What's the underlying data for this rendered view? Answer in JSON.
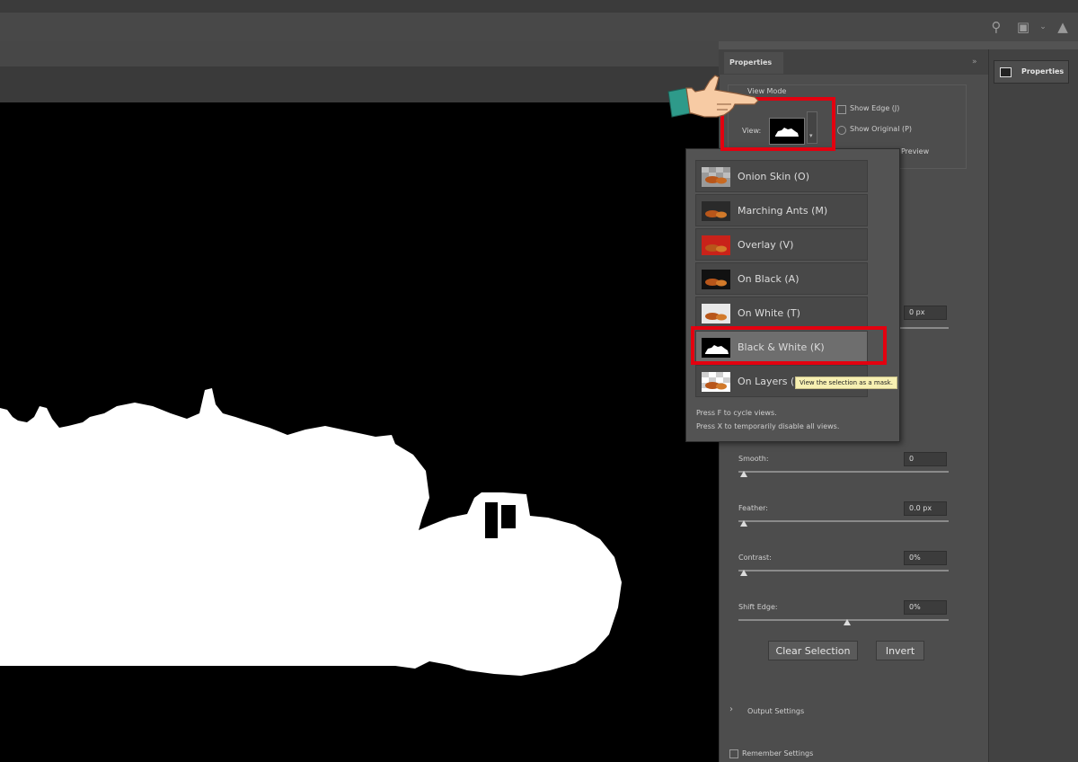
{
  "properties_panel": {
    "tab_label": "Properties",
    "dock_button_label": "Properties",
    "view_mode_label": "View Mode",
    "view_label": "View:",
    "show_edge_label": "Show Edge (J)",
    "show_original_label": "Show Original (P)",
    "preview_label": "Preview",
    "radius_value": "0 px",
    "smooth_label": "Smooth:",
    "smooth_value": "0",
    "feather_label": "Feather:",
    "feather_value": "0.0 px",
    "contrast_label": "Contrast:",
    "contrast_value": "0%",
    "shift_edge_label": "Shift Edge:",
    "shift_edge_value": "0%",
    "clear_selection_label": "Clear Selection",
    "invert_label": "Invert",
    "output_settings_label": "Output Settings",
    "remember_settings_label": "Remember Settings"
  },
  "view_menu": {
    "items": [
      {
        "label": "Onion Skin (O)",
        "thumb": "onion"
      },
      {
        "label": "Marching Ants (M)",
        "thumb": "ants"
      },
      {
        "label": "Overlay (V)",
        "thumb": "overlay"
      },
      {
        "label": "On Black (A)",
        "thumb": "black"
      },
      {
        "label": "On White (T)",
        "thumb": "white"
      },
      {
        "label": "Black & White (K)",
        "thumb": "bw"
      },
      {
        "label": "On Layers (",
        "thumb": "layers"
      }
    ],
    "selected": "Black & White (K)",
    "hint_line_1": "Press F to cycle views.",
    "hint_line_2": "Press X to temporarily disable all views.",
    "tooltip": "View the selection as a mask."
  },
  "icons": [
    "search-icon",
    "workspace-icon",
    "share-icon",
    "pointing-hand-icon",
    "chevron-right-icon",
    "collapse-panel-icon"
  ],
  "colors": {
    "highlight_red": "#e3000f",
    "tooltip_bg": "#f7f0b2",
    "panel_bg": "#4d4d4d",
    "canvas_bg": "#000000"
  }
}
